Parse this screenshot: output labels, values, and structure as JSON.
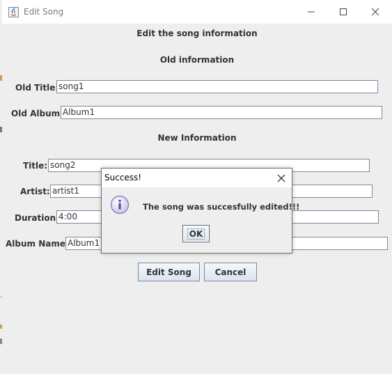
{
  "window": {
    "title": "Edit Song"
  },
  "form": {
    "heading": "Edit the song information",
    "old_section_heading": "Old information",
    "new_section_heading": "New Information",
    "old_title": {
      "label": "Old Title:",
      "value": "song1"
    },
    "old_album": {
      "label": "Old Album:",
      "value": "Album1"
    },
    "title": {
      "label": "Title:",
      "value": "song2"
    },
    "artist": {
      "label": "Artist:",
      "value": "artist1"
    },
    "duration": {
      "label": "Duration:",
      "value": "4:00"
    },
    "album_name": {
      "label": "Album Name:",
      "value": "Album1"
    },
    "edit_button": "Edit Song",
    "cancel_button": "Cancel"
  },
  "dialog": {
    "title": "Success!",
    "message": "The song was succesfully edited!!!",
    "ok_button": "OK"
  },
  "icons": {
    "app": "java-icon",
    "minimize": "minimize-icon",
    "maximize": "maximize-icon",
    "close": "close-icon",
    "info": "info-icon"
  }
}
